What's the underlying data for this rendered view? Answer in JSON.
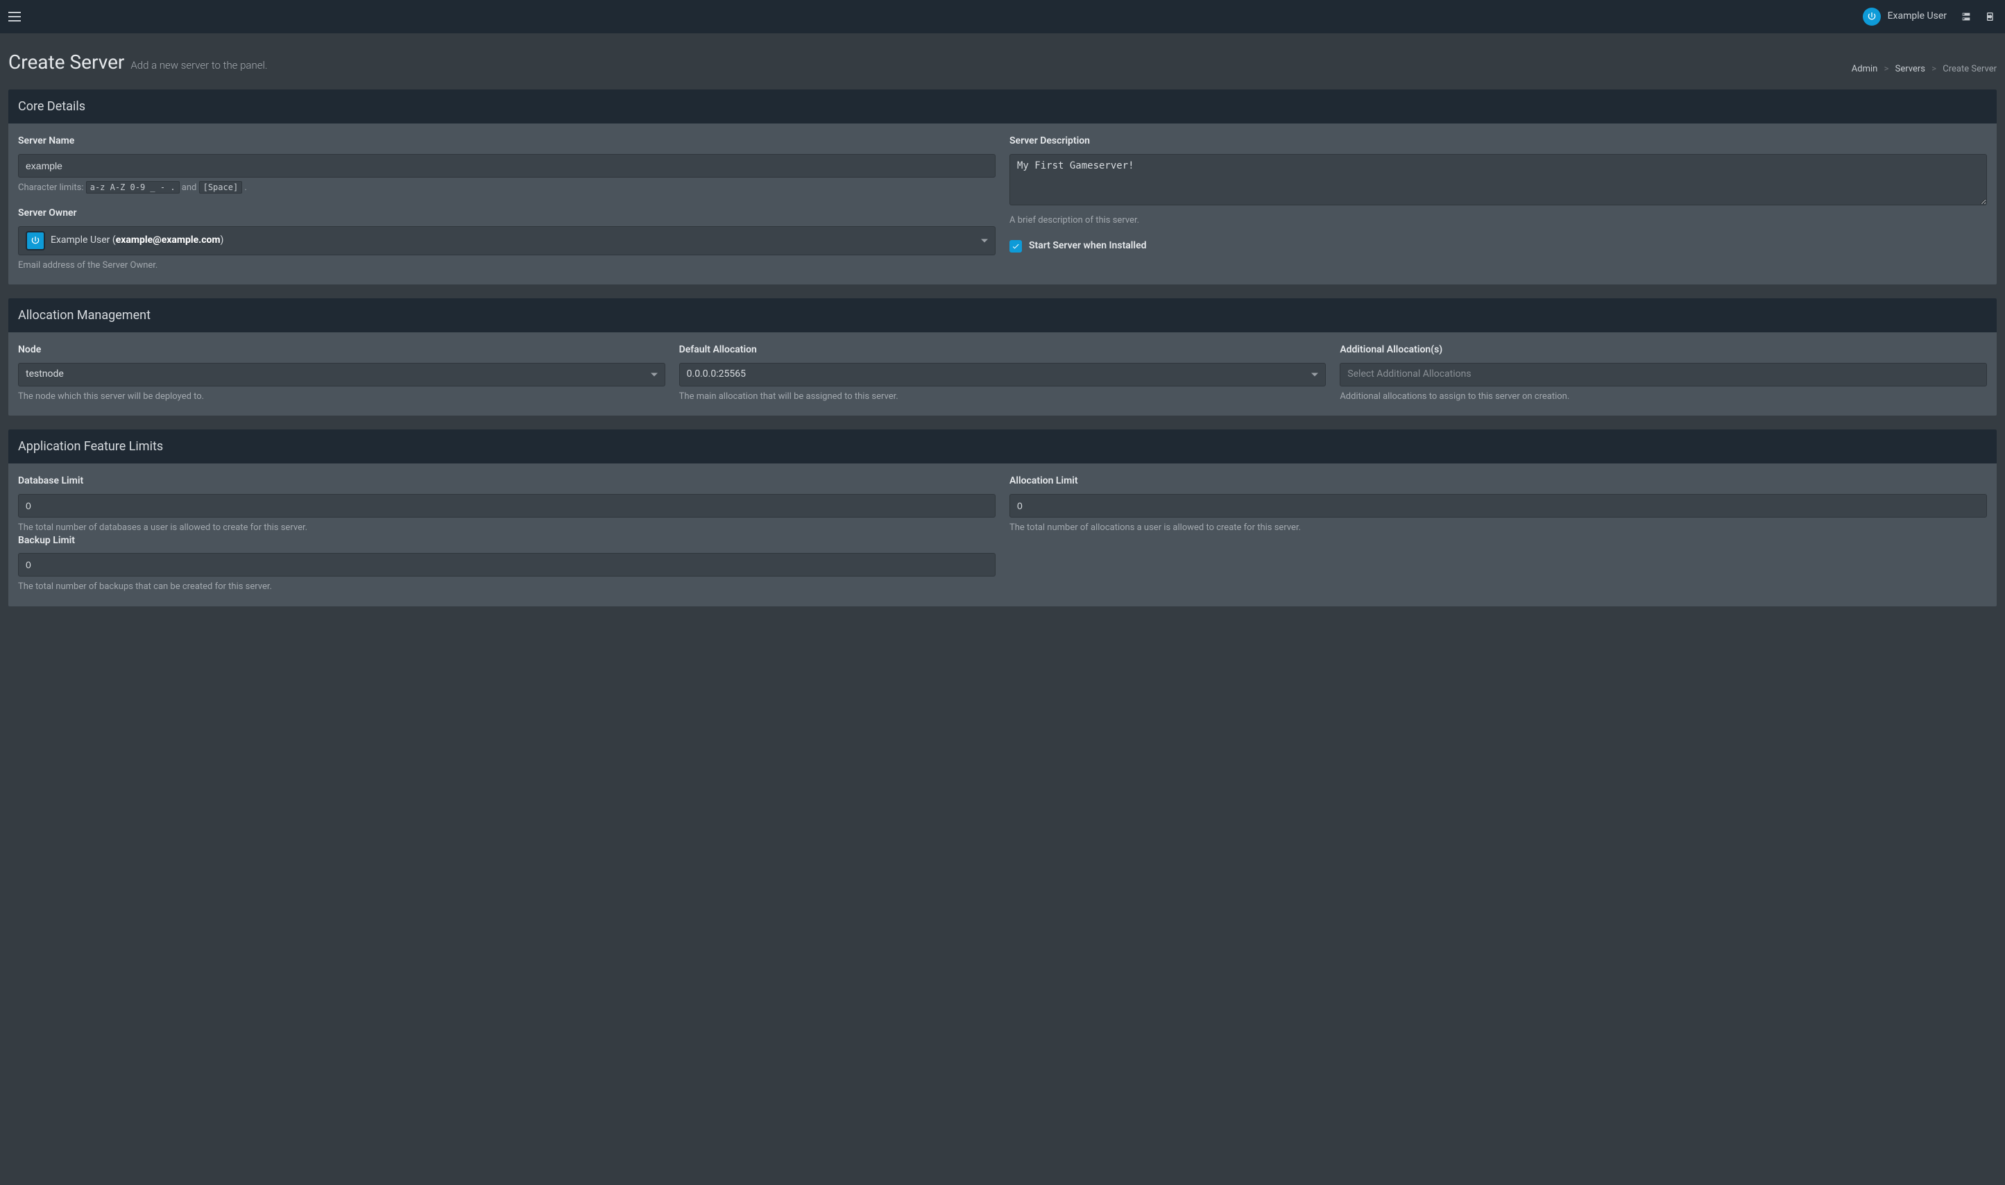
{
  "navbar": {
    "user_name": "Example User"
  },
  "page": {
    "title": "Create Server",
    "subtitle": "Add a new server to the panel."
  },
  "breadcrumb": {
    "admin": "Admin",
    "servers": "Servers",
    "current": "Create Server"
  },
  "core": {
    "header": "Core Details",
    "server_name": {
      "label": "Server Name",
      "value": "example",
      "help_prefix": "Character limits: ",
      "help_code1": "a-z A-Z 0-9 _ - .",
      "help_mid": " and ",
      "help_code2": "[Space]",
      "help_suffix": " ."
    },
    "server_owner": {
      "label": "Server Owner",
      "display_name": "Example User (",
      "display_email": "example@example.com",
      "display_close": ")",
      "help": "Email address of the Server Owner."
    },
    "server_description": {
      "label": "Server Description",
      "value": "My First Gameserver!",
      "help": "A brief description of this server."
    },
    "start_on_install": {
      "label": "Start Server when Installed",
      "checked": true
    }
  },
  "allocation": {
    "header": "Allocation Management",
    "node": {
      "label": "Node",
      "value": "testnode",
      "help": "The node which this server will be deployed to."
    },
    "default": {
      "label": "Default Allocation",
      "value": "0.0.0.0:25565",
      "help": "The main allocation that will be assigned to this server."
    },
    "additional": {
      "label": "Additional Allocation(s)",
      "placeholder": "Select Additional Allocations",
      "help": "Additional allocations to assign to this server on creation."
    }
  },
  "limits": {
    "header": "Application Feature Limits",
    "database": {
      "label": "Database Limit",
      "value": "0",
      "help": "The total number of databases a user is allowed to create for this server."
    },
    "allocation_limit": {
      "label": "Allocation Limit",
      "value": "0",
      "help": "The total number of allocations a user is allowed to create for this server."
    },
    "backup": {
      "label": "Backup Limit",
      "value": "0",
      "help": "The total number of backups that can be created for this server."
    }
  }
}
